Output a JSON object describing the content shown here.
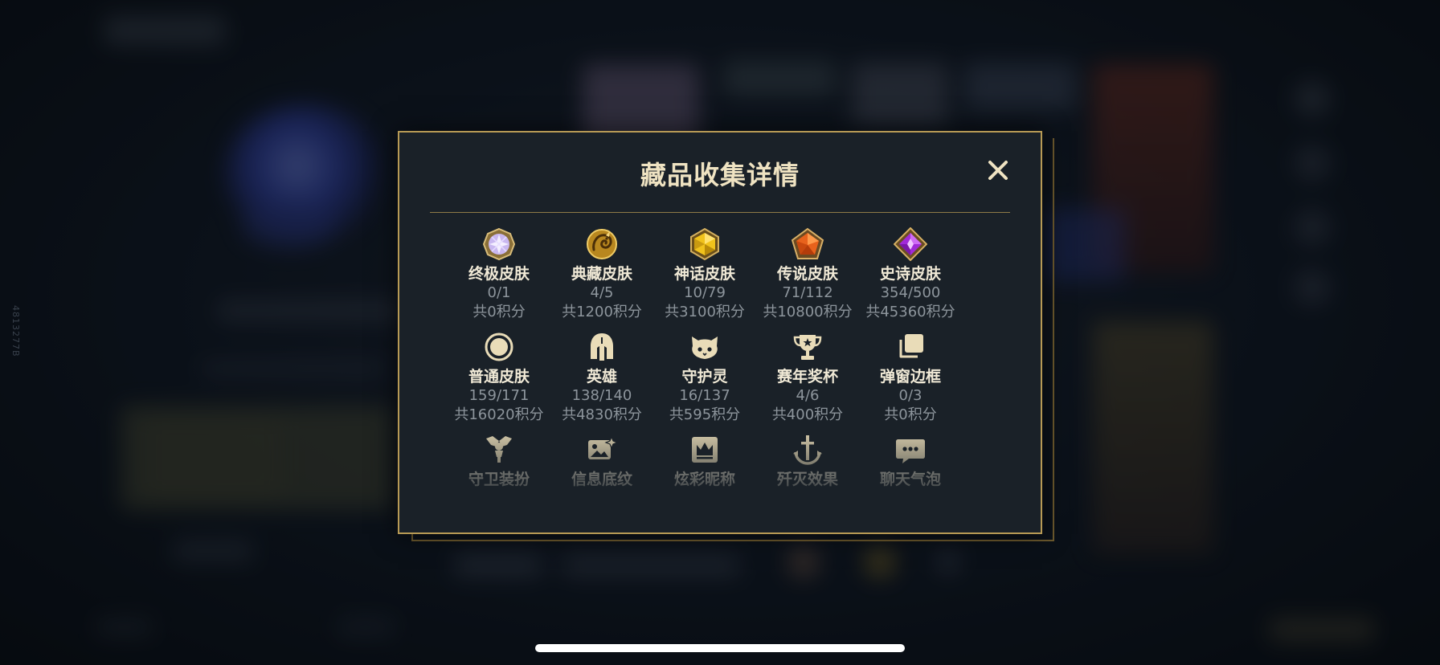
{
  "side_id": "4813277B",
  "modal": {
    "title": "藏品收集详情",
    "close_icon": "close-icon",
    "colors": {
      "gold": "#b79a55",
      "title": "#efe3c2",
      "label": "#f0e9d6",
      "muted": "#8d959c"
    }
  },
  "categories": [
    {
      "key": "ultimate",
      "icon": "ultimate-gem-icon",
      "name": "终极皮肤",
      "count": "0/1",
      "points": "共0积分"
    },
    {
      "key": "prestige",
      "icon": "dragon-emblem-icon",
      "name": "典藏皮肤",
      "count": "4/5",
      "points": "共1200积分"
    },
    {
      "key": "mythic",
      "icon": "mythic-gem-icon",
      "name": "神话皮肤",
      "count": "10/79",
      "points": "共3100积分"
    },
    {
      "key": "legendary",
      "icon": "legendary-gem-icon",
      "name": "传说皮肤",
      "count": "71/112",
      "points": "共10800积分"
    },
    {
      "key": "epic",
      "icon": "epic-gem-icon",
      "name": "史诗皮肤",
      "count": "354/500",
      "points": "共45360积分"
    },
    {
      "key": "standard",
      "icon": "circle-icon",
      "name": "普通皮肤",
      "count": "159/171",
      "points": "共16020积分"
    },
    {
      "key": "champions",
      "icon": "helmet-icon",
      "name": "英雄",
      "count": "138/140",
      "points": "共4830积分"
    },
    {
      "key": "companions",
      "icon": "companion-face-icon",
      "name": "守护灵",
      "count": "16/137",
      "points": "共595积分"
    },
    {
      "key": "trophies",
      "icon": "trophy-icon",
      "name": "赛年奖杯",
      "count": "4/6",
      "points": "共400积分"
    },
    {
      "key": "frames",
      "icon": "stacked-frames-icon",
      "name": "弹窗边框",
      "count": "0/3",
      "points": "共0积分"
    },
    {
      "key": "ward",
      "icon": "ward-totem-icon",
      "name": "守卫装扮",
      "count": "",
      "points": ""
    },
    {
      "key": "banner",
      "icon": "image-sparkle-icon",
      "name": "信息底纹",
      "count": "",
      "points": ""
    },
    {
      "key": "nickname",
      "icon": "crown-card-icon",
      "name": "炫彩昵称",
      "count": "",
      "points": ""
    },
    {
      "key": "annihilate",
      "icon": "anchor-sword-icon",
      "name": "歼灭效果",
      "count": "",
      "points": ""
    },
    {
      "key": "bubble",
      "icon": "chat-bubble-icon",
      "name": "聊天气泡",
      "count": "",
      "points": ""
    }
  ]
}
